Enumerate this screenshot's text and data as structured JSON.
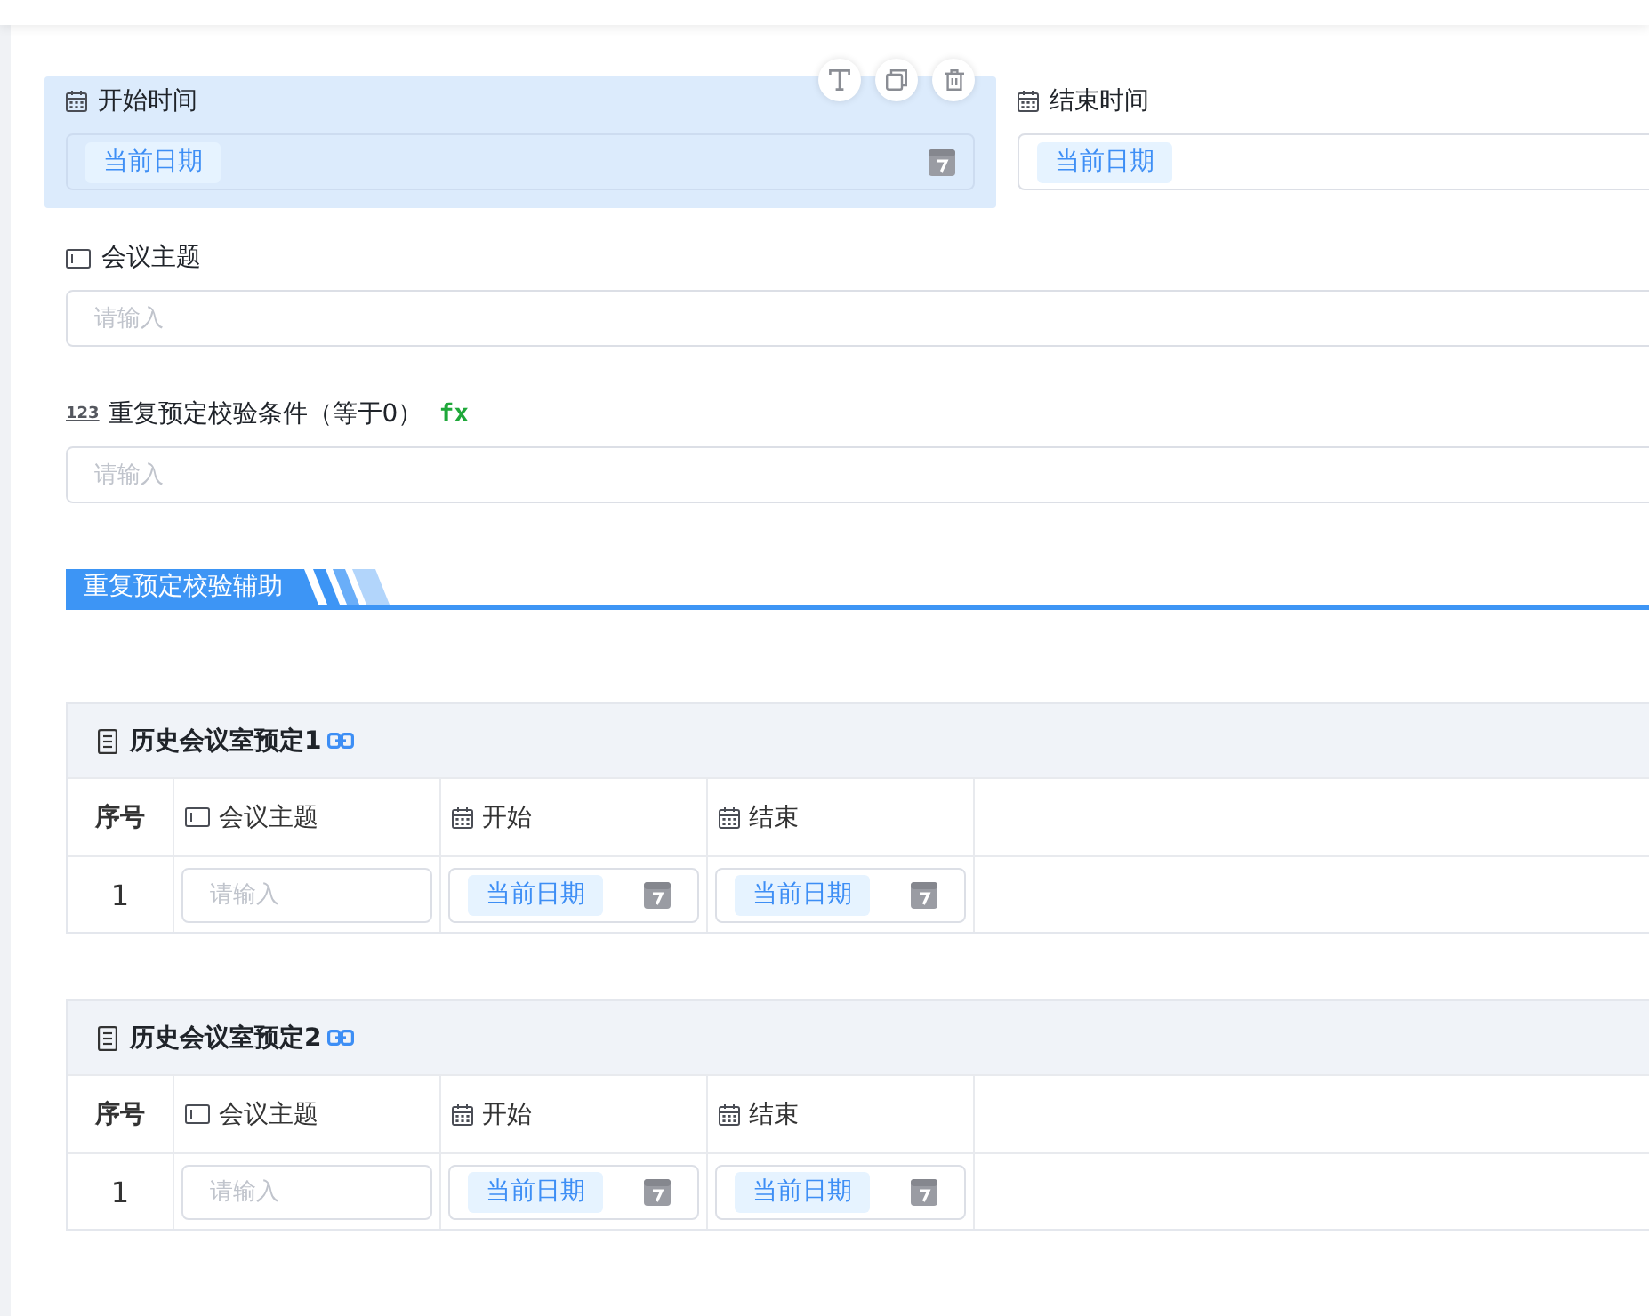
{
  "form": {
    "rows": [
      {
        "fields": [
          {
            "kind": "date",
            "label": "开始时间",
            "value": "当前日期",
            "selected": true
          },
          {
            "kind": "date",
            "label": "结束时间",
            "value": "当前日期",
            "selected": false
          }
        ]
      },
      {
        "fields": [
          {
            "kind": "text",
            "label": "会议主题",
            "placeholder": "请输入",
            "selected": false
          }
        ]
      },
      {
        "fields": [
          {
            "kind": "number",
            "type_mark": "123",
            "label": "重复预定校验条件（等于0）",
            "formula": "fx",
            "placeholder": "请输入",
            "selected": false
          }
        ]
      }
    ]
  },
  "section": {
    "title": "重复预定校验辅助"
  },
  "subtables": [
    {
      "title": "历史会议室预定1",
      "columns": [
        {
          "kind": "index",
          "label": "序号"
        },
        {
          "kind": "text",
          "label": "会议主题"
        },
        {
          "kind": "date",
          "label": "开始"
        },
        {
          "kind": "date",
          "label": "结束"
        }
      ],
      "rows": [
        {
          "cells": [
            {
              "kind": "index",
              "text": "1"
            },
            {
              "kind": "text",
              "placeholder": "请输入"
            },
            {
              "kind": "date",
              "value": "当前日期"
            },
            {
              "kind": "date",
              "value": "当前日期"
            }
          ]
        }
      ]
    },
    {
      "title": "历史会议室预定2",
      "columns": [
        {
          "kind": "index",
          "label": "序号"
        },
        {
          "kind": "text",
          "label": "会议主题"
        },
        {
          "kind": "date",
          "label": "开始"
        },
        {
          "kind": "date",
          "label": "结束"
        }
      ],
      "rows": [
        {
          "cells": [
            {
              "kind": "index",
              "text": "1"
            },
            {
              "kind": "text",
              "placeholder": "请输入"
            },
            {
              "kind": "date",
              "value": "当前日期"
            },
            {
              "kind": "date",
              "value": "当前日期"
            }
          ]
        }
      ]
    }
  ]
}
